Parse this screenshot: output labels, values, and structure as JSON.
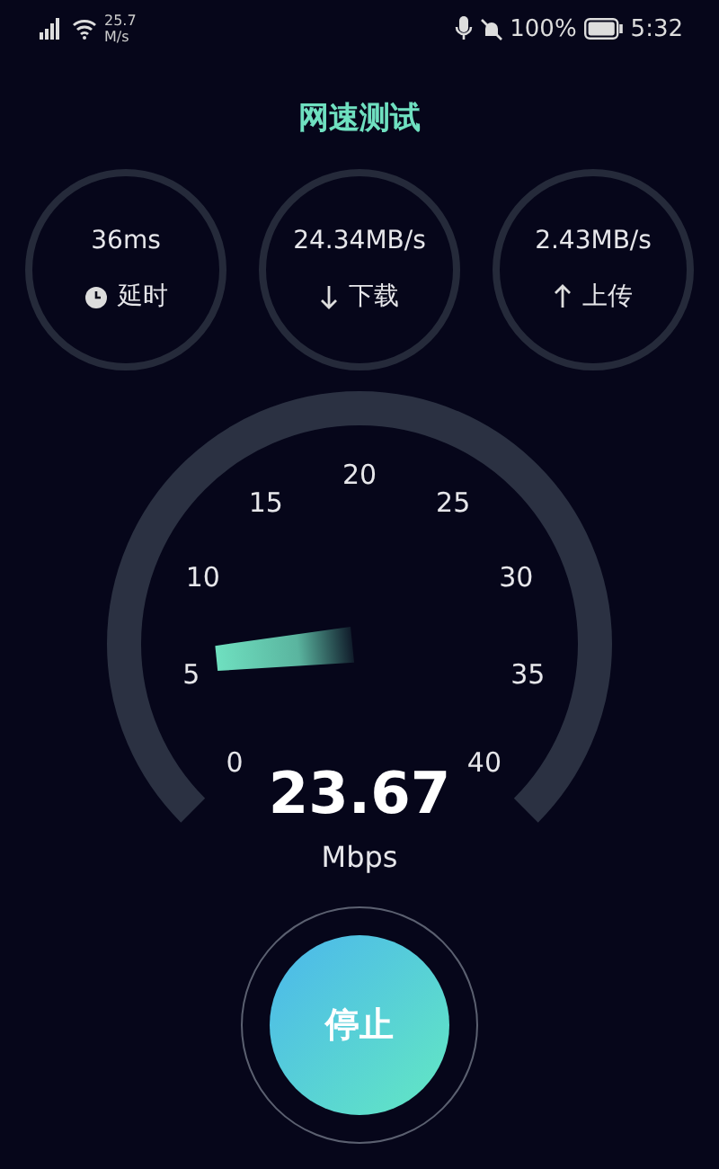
{
  "status_bar": {
    "net_speed": "25.7",
    "net_unit": "M/s",
    "battery": "100%",
    "time": "5:32"
  },
  "title": "网速测试",
  "stats": [
    {
      "kind": "latency",
      "value": "36ms",
      "label": "延时"
    },
    {
      "kind": "download",
      "value": "24.34MB/s",
      "label": "下载"
    },
    {
      "kind": "upload",
      "value": "2.43MB/s",
      "label": "上传"
    }
  ],
  "gauge": {
    "ticks": [
      "0",
      "5",
      "10",
      "15",
      "20",
      "25",
      "30",
      "35",
      "40"
    ],
    "value": "23.67",
    "unit": "Mbps"
  },
  "button": "停止"
}
